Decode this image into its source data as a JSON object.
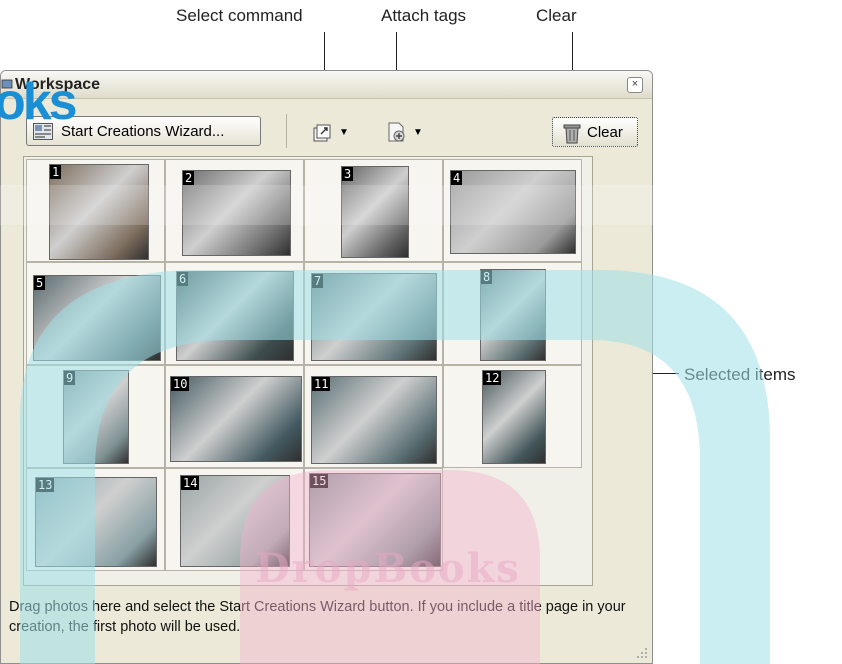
{
  "callouts": {
    "select_command": "Select command",
    "attach_tags": "Attach tags",
    "clear": "Clear",
    "selected_items": "Selected items"
  },
  "window": {
    "title": "Workspace",
    "logo_text": "oks",
    "close_symbol": "×"
  },
  "toolbar": {
    "wizard_label": "Start Creations Wizard...",
    "clear_label": "Clear",
    "dropdown_arrow": "▼"
  },
  "photos": [
    {
      "n": "1",
      "tone": "#7d6d5d"
    },
    {
      "n": "2",
      "tone": "#6e6e6e"
    },
    {
      "n": "3",
      "tone": "#646464"
    },
    {
      "n": "4",
      "tone": "#9a9a9a"
    },
    {
      "n": "5",
      "tone": "#5a6a6e"
    },
    {
      "n": "6",
      "tone": "#3d4d4e"
    },
    {
      "n": "7",
      "tone": "#5f7476"
    },
    {
      "n": "8",
      "tone": "#5e7172"
    },
    {
      "n": "9",
      "tone": "#7e9093"
    },
    {
      "n": "10",
      "tone": "#445b61"
    },
    {
      "n": "11",
      "tone": "#5a6f74"
    },
    {
      "n": "12",
      "tone": "#43565a"
    },
    {
      "n": "13",
      "tone": "#88a0a4"
    },
    {
      "n": "14",
      "tone": "#9aa6a6"
    },
    {
      "n": "15",
      "tone": "#7b8d8f"
    }
  ],
  "hint_text": "Drag photos here and select the Start Creations Wizard button. If you include a title page in your creation, the first photo will be used.",
  "watermark": "DropBooks",
  "colors": {
    "panel_bg": "#ece9d8",
    "overlay": "#9fe0e8",
    "logo": "#1a8fd6"
  }
}
